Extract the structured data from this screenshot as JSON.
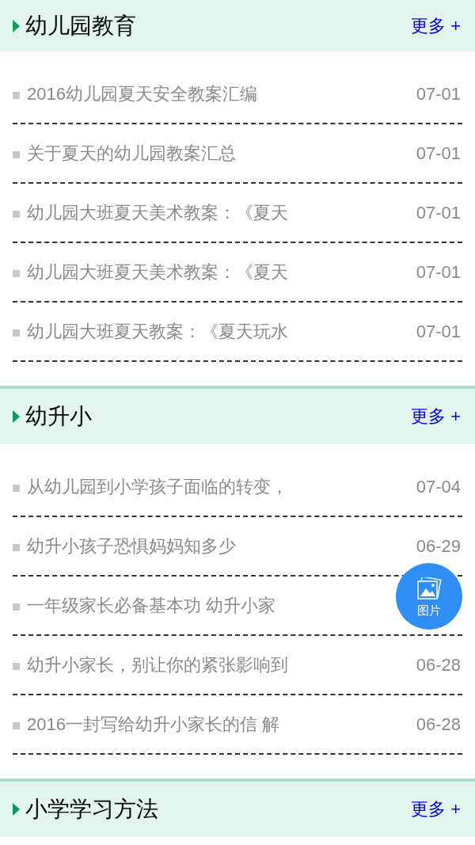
{
  "sections": [
    {
      "title": "幼儿园教育",
      "more": "更多 +",
      "items": [
        {
          "title": "2016幼儿园夏天安全教案汇编",
          "date": "07-01"
        },
        {
          "title": "关于夏天的幼儿园教案汇总",
          "date": "07-01"
        },
        {
          "title": "幼儿园大班夏天美术教案：《夏天",
          "date": "07-01"
        },
        {
          "title": "幼儿园大班夏天美术教案：《夏天",
          "date": "07-01"
        },
        {
          "title": "幼儿园大班夏天教案：《夏天玩水",
          "date": "07-01"
        }
      ]
    },
    {
      "title": "幼升小",
      "more": "更多 +",
      "items": [
        {
          "title": "从幼儿园到小学孩子面临的转变，",
          "date": "07-04"
        },
        {
          "title": "幼升小孩子恐惧妈妈知多少",
          "date": "06-29"
        },
        {
          "title": "一年级家长必备基本功 幼升小家"
        },
        {
          "title": "幼升小家长，别让你的紧张影响到",
          "date": "06-28"
        },
        {
          "title": "2016一封写给幼升小家长的信 解",
          "date": "06-28"
        }
      ]
    },
    {
      "title": "小学学习方法",
      "more": "更多 +"
    }
  ],
  "floating_button": {
    "label": "图片"
  }
}
